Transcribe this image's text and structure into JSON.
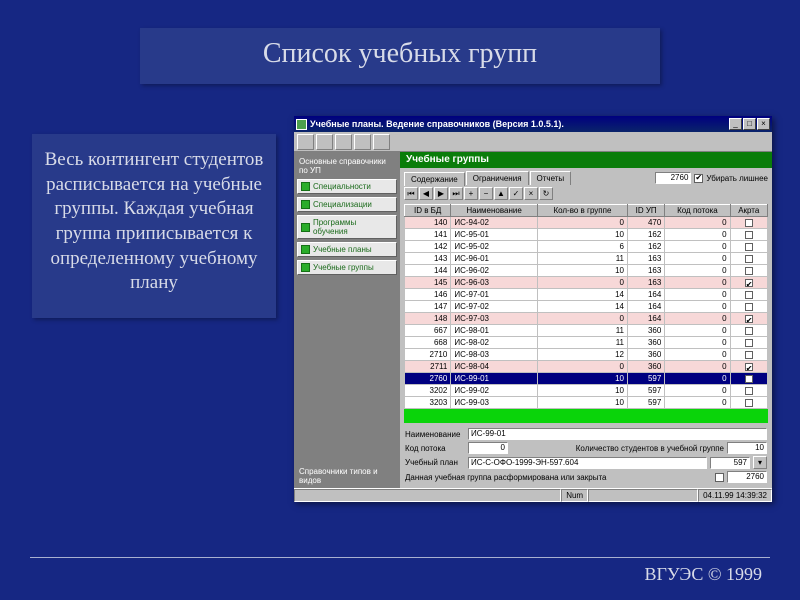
{
  "slide": {
    "title": "Список учебных групп",
    "body": "Весь контингент студентов расписывается на учебные группы. Каждая учебная группа приписывается к определенному учебному плану",
    "footer": "ВГУЭС © 1999"
  },
  "app": {
    "title": "Учебные планы. Ведение справочников (Версия 1.0.5.1).",
    "sidebar": {
      "header": "Основные справочники по УП",
      "items": [
        {
          "label": "Специальности"
        },
        {
          "label": "Специализации"
        },
        {
          "label": "Программы обучения"
        },
        {
          "label": "Учебные планы"
        },
        {
          "label": "Учебные группы"
        }
      ],
      "footer": "Справочники типов и видов"
    },
    "main_header": "Учебные группы",
    "tabs": [
      "Содержание",
      "Ограничения",
      "Отчеты"
    ],
    "id_value": "2760",
    "checkbox_label": "Убирать лишнее",
    "grid": {
      "columns": [
        "ID в БД",
        "Наименование",
        "Кол-во в группе",
        "ID УП",
        "Код потока",
        "Акрта"
      ],
      "rows": [
        {
          "id": "140",
          "name": "ИС-94-02",
          "cnt": "0",
          "idup": "470",
          "kod": "0",
          "chk": false,
          "alt": true
        },
        {
          "id": "141",
          "name": "ИС-95-01",
          "cnt": "10",
          "idup": "162",
          "kod": "0",
          "chk": false,
          "alt": false
        },
        {
          "id": "142",
          "name": "ИС-95-02",
          "cnt": "6",
          "idup": "162",
          "kod": "0",
          "chk": false,
          "alt": false
        },
        {
          "id": "143",
          "name": "ИС-96-01",
          "cnt": "11",
          "idup": "163",
          "kod": "0",
          "chk": false,
          "alt": false
        },
        {
          "id": "144",
          "name": "ИС-96-02",
          "cnt": "10",
          "idup": "163",
          "kod": "0",
          "chk": false,
          "alt": false
        },
        {
          "id": "145",
          "name": "ИС-96-03",
          "cnt": "0",
          "idup": "163",
          "kod": "0",
          "chk": true,
          "alt": true
        },
        {
          "id": "146",
          "name": "ИС-97-01",
          "cnt": "14",
          "idup": "164",
          "kod": "0",
          "chk": false,
          "alt": false
        },
        {
          "id": "147",
          "name": "ИС-97-02",
          "cnt": "14",
          "idup": "164",
          "kod": "0",
          "chk": false,
          "alt": false
        },
        {
          "id": "148",
          "name": "ИС-97-03",
          "cnt": "0",
          "idup": "164",
          "kod": "0",
          "chk": true,
          "alt": true
        },
        {
          "id": "667",
          "name": "ИС-98-01",
          "cnt": "11",
          "idup": "360",
          "kod": "0",
          "chk": false,
          "alt": false
        },
        {
          "id": "668",
          "name": "ИС-98-02",
          "cnt": "11",
          "idup": "360",
          "kod": "0",
          "chk": false,
          "alt": false
        },
        {
          "id": "2710",
          "name": "ИС-98-03",
          "cnt": "12",
          "idup": "360",
          "kod": "0",
          "chk": false,
          "alt": false
        },
        {
          "id": "2711",
          "name": "ИС-98-04",
          "cnt": "0",
          "idup": "360",
          "kod": "0",
          "chk": true,
          "alt": true
        },
        {
          "id": "2760",
          "name": "ИС-99-01",
          "cnt": "10",
          "idup": "597",
          "kod": "0",
          "chk": false,
          "sel": true
        },
        {
          "id": "3202",
          "name": "ИС-99-02",
          "cnt": "10",
          "idup": "597",
          "kod": "0",
          "chk": false,
          "alt": false
        },
        {
          "id": "3203",
          "name": "ИС-99-03",
          "cnt": "10",
          "idup": "597",
          "kod": "0",
          "chk": false,
          "alt": false
        }
      ]
    },
    "form": {
      "name_label": "Наименование",
      "name_value": "ИС-99-01",
      "kod_label": "Код потока",
      "kod_value": "0",
      "count_label": "Количество студентов в учебной группе",
      "count_value": "10",
      "plan_label": "Учебный план",
      "plan_value": "ИС-С-ОФО-1999-ЭН-597.604",
      "plan_id": "597",
      "note": "Данная учебная группа расформирована или закрыта",
      "bottom_id": "2760"
    },
    "status": {
      "num": "Num",
      "datetime": "04.11.99 14:39:32"
    }
  }
}
